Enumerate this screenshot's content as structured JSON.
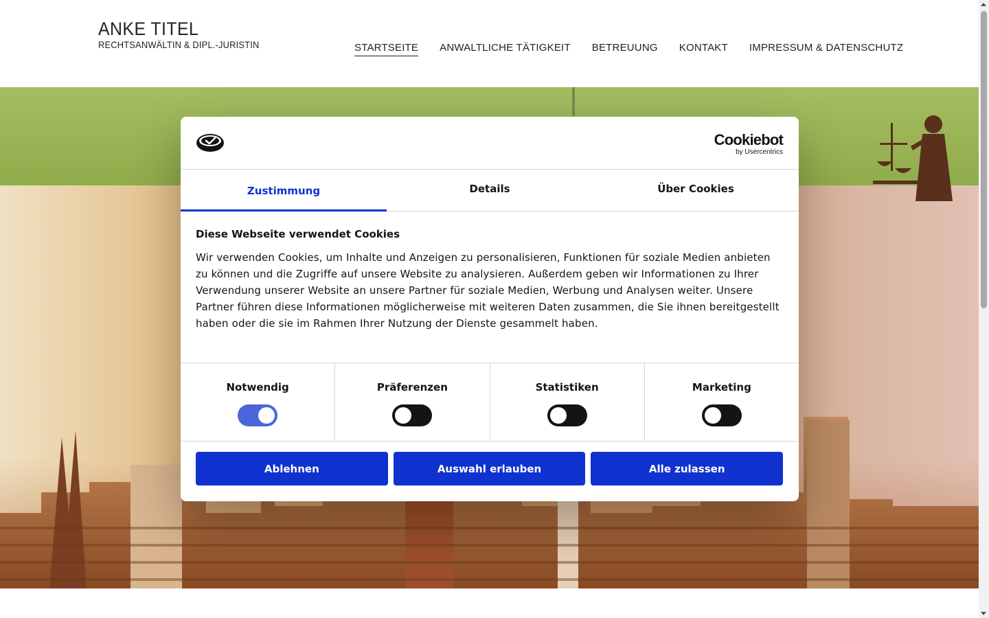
{
  "site": {
    "name": "ANKE TITEL",
    "subtitle": "RECHTSANWÄLTIN & DIPL.-JURISTIN"
  },
  "nav": {
    "items": [
      {
        "label": "STARTSEITE",
        "active": true
      },
      {
        "label": "ANWALTLICHE TÄTIGKEIT",
        "active": false
      },
      {
        "label": "BETREUUNG",
        "active": false
      },
      {
        "label": "KONTAKT",
        "active": false
      },
      {
        "label": "IMPRESSUM & DATENSCHUTZ",
        "active": false
      }
    ]
  },
  "cookie_dialog": {
    "brand": {
      "name": "Cookiebot",
      "by": "by Usercentrics"
    },
    "tabs": [
      {
        "label": "Zustimmung",
        "active": true
      },
      {
        "label": "Details",
        "active": false
      },
      {
        "label": "Über Cookies",
        "active": false
      }
    ],
    "heading": "Diese Webseite verwendet Cookies",
    "text": "Wir verwenden Cookies, um Inhalte und Anzeigen zu personalisieren, Funktionen für soziale Medien anbieten zu können und die Zugriffe auf unsere Website zu analysieren. Außerdem geben wir Informationen zu Ihrer Verwendung unserer Website an unsere Partner für soziale Medien, Werbung und Analysen weiter. Unsere Partner führen diese Informationen möglicherweise mit weiteren Daten zusammen, die Sie ihnen bereitgestellt haben oder die sie im Rahmen Ihrer Nutzung der Dienste gesammelt haben.",
    "categories": [
      {
        "label": "Notwendig",
        "checked": true,
        "disabled": true
      },
      {
        "label": "Präferenzen",
        "checked": false,
        "disabled": false
      },
      {
        "label": "Statistiken",
        "checked": false,
        "disabled": false
      },
      {
        "label": "Marketing",
        "checked": false,
        "disabled": false
      }
    ],
    "buttons": {
      "decline": "Ablehnen",
      "allow_selection": "Auswahl erlauben",
      "allow_all": "Alle zulassen"
    }
  },
  "colors": {
    "accent": "#1032cf",
    "toggle_off": "#141414",
    "hero_green": "#9bb556"
  }
}
